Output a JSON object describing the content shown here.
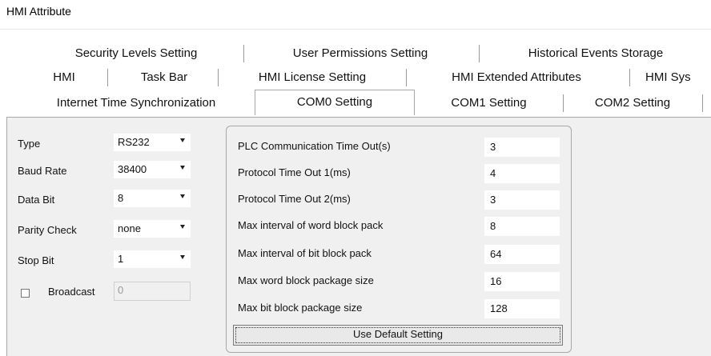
{
  "window": {
    "title": "HMI Attribute"
  },
  "tabs": {
    "row1": [
      "Security Levels Setting",
      "User Permissions Setting",
      "Historical Events Storage"
    ],
    "row2": [
      "HMI",
      "Task Bar",
      "HMI License Setting",
      "HMI Extended Attributes",
      "HMI Sys"
    ],
    "row3": [
      "Internet Time Synchronization",
      "COM0 Setting",
      "COM1 Setting",
      "COM2 Setting"
    ],
    "active": "COM0 Setting"
  },
  "left": {
    "type": {
      "label": "Type",
      "value": "RS232"
    },
    "baud": {
      "label": "Baud Rate",
      "value": "38400"
    },
    "databit": {
      "label": "Data Bit",
      "value": "8"
    },
    "parity": {
      "label": "Parity Check",
      "value": "none"
    },
    "stopbit": {
      "label": "Stop Bit",
      "value": "1"
    },
    "broadcast": {
      "label": "Broadcast",
      "value": "0",
      "checked": false
    }
  },
  "timeouts": {
    "rows": [
      {
        "label": "PLC Communication Time Out(s)",
        "value": "3"
      },
      {
        "label": "Protocol Time Out 1(ms)",
        "value": "4"
      },
      {
        "label": "Protocol Time Out 2(ms)",
        "value": "3"
      },
      {
        "label": "Max interval of word block pack",
        "value": "8"
      },
      {
        "label": "Max interval of bit block pack",
        "value": "64"
      },
      {
        "label": "Max word block package size",
        "value": "16"
      },
      {
        "label": "Max bit block package size",
        "value": "128"
      }
    ],
    "default_button": "Use Default Setting"
  }
}
